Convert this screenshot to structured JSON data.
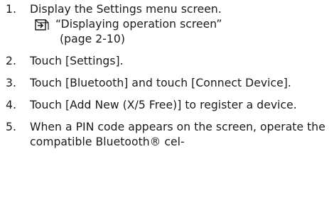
{
  "steps": [
    {
      "number": "1.",
      "text": "Display the Settings menu screen.",
      "reference": {
        "icon": "page-reference-icon",
        "title": "“Displaying operation screen”",
        "page": "(page 2-10)"
      }
    },
    {
      "number": "2.",
      "text": "Touch [Settings]."
    },
    {
      "number": "3.",
      "text": "Touch [Bluetooth] and touch [Connect Device]."
    },
    {
      "number": "4.",
      "text": "Touch [Add New (X/5 Free)] to register a device."
    },
    {
      "number": "5.",
      "text": "When a PIN code appears on the screen, operate the compatible Bluetooth® cel-"
    }
  ]
}
